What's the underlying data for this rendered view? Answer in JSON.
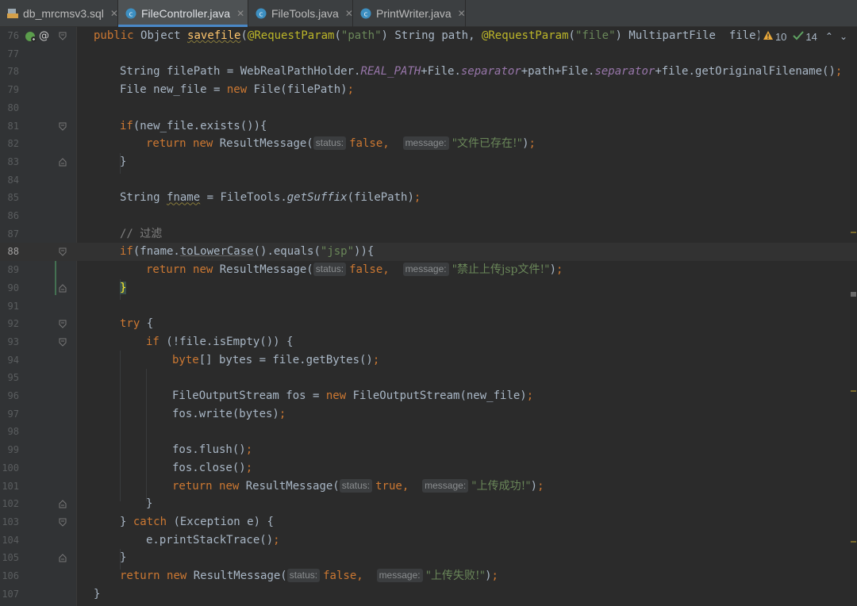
{
  "tabs": [
    {
      "label": "db_mrcmsv3.sql",
      "icon": "sql-file-icon",
      "active": false
    },
    {
      "label": "FileController.java",
      "icon": "java-class-icon",
      "active": true
    },
    {
      "label": "FileTools.java",
      "icon": "java-class-icon",
      "active": false
    },
    {
      "label": "PrintWriter.java",
      "icon": "java-class-icon",
      "active": false
    }
  ],
  "inspection": {
    "warnings": "10",
    "ok": "14"
  },
  "line_numbers": [
    "76",
    "77",
    "78",
    "79",
    "80",
    "81",
    "82",
    "83",
    "84",
    "85",
    "86",
    "87",
    "88",
    "89",
    "90",
    "91",
    "92",
    "93",
    "94",
    "95",
    "96",
    "97",
    "98",
    "99",
    "100",
    "101",
    "102",
    "103",
    "104",
    "105",
    "106",
    "107"
  ],
  "current_line": "88",
  "code": {
    "l76_a": "public ",
    "l76_b": "Object ",
    "l76_fn": "savefile",
    "l76_c": "(",
    "l76_ann1": "@RequestParam",
    "l76_d": "(",
    "l76_s1": "\"path\"",
    "l76_e": ") String path, ",
    "l76_ann2": "@RequestParam",
    "l76_f": "(",
    "l76_s2": "\"file\"",
    "l76_g": ") MultipartFile  file){",
    "l78_a": "String filePath = WebRealPathHolder.",
    "l78_f1": "REAL_PATH",
    "l78_b": "+File.",
    "l78_f2": "separator",
    "l78_c": "+path+File.",
    "l78_f3": "separator",
    "l78_d": "+file.getOriginalFilename()",
    "l78_semi": ";",
    "l79_a": "File new_file = ",
    "l79_kw": "new ",
    "l79_b": "File(filePath)",
    "l79_semi": ";",
    "l81_kw": "if",
    "l81_a": "(new_file.exists()){",
    "l82_kw1": "return ",
    "l82_kw2": "new ",
    "l82_a": "ResultMessage(",
    "l82_h1": "status:",
    "l82_v1": "false",
    "l82_comma": ",",
    "l82_h2": "message:",
    "l82_s": "\"文件已存在!\"",
    "l82_b": ")",
    "l82_semi": ";",
    "l83": "}",
    "l85_a": "String ",
    "l85_var": "fname",
    "l85_b": " = FileTools.",
    "l85_fn": "getSuffix",
    "l85_c": "(filePath)",
    "l85_semi": ";",
    "l87": "// 过滤",
    "l88_kw": "if",
    "l88_a": "(fname.",
    "l88_m": "toLowerCase",
    "l88_b": "().equals(",
    "l88_s": "\"jsp\"",
    "l88_c": ")){",
    "l89_kw1": "return ",
    "l89_kw2": "new ",
    "l89_a": "ResultMessage(",
    "l89_h1": "status:",
    "l89_v1": "false",
    "l89_comma": ",",
    "l89_h2": "message:",
    "l89_s": "\"禁止上传jsp文件!\"",
    "l89_b": ")",
    "l89_semi": ";",
    "l90": "}",
    "l92_kw": "try ",
    "l92_a": "{",
    "l93_kw": "if ",
    "l93_a": "(!file.isEmpty()) {",
    "l94_kw": "byte",
    "l94_a": "[] bytes = file.getBytes()",
    "l94_semi": ";",
    "l96_a": "FileOutputStream fos = ",
    "l96_kw": "new ",
    "l96_b": "FileOutputStream(new_file)",
    "l96_semi": ";",
    "l97_a": "fos.write(bytes)",
    "l97_semi": ";",
    "l99_a": "fos.flush()",
    "l99_semi": ";",
    "l100_a": "fos.close()",
    "l100_semi": ";",
    "l101_kw1": "return ",
    "l101_kw2": "new ",
    "l101_a": "ResultMessage(",
    "l101_h1": "status:",
    "l101_v1": "true",
    "l101_comma": ",",
    "l101_h2": "message:",
    "l101_s": "\"上传成功!\"",
    "l101_b": ")",
    "l101_semi": ";",
    "l102": "}",
    "l103_a": "} ",
    "l103_kw": "catch ",
    "l103_b": "(Exception e) {",
    "l104_a": "e.printStackTrace()",
    "l104_semi": ";",
    "l105": "}",
    "l106_kw1": "return ",
    "l106_kw2": "new ",
    "l106_a": "ResultMessage(",
    "l106_h1": "status:",
    "l106_v1": "false",
    "l106_comma": ",",
    "l106_h2": "message:",
    "l106_s": "\"上传失败!\"",
    "l106_b": ")",
    "l106_semi": ";",
    "l107": "}"
  },
  "colors": {
    "keyword": "#cc7832",
    "string": "#6a8759",
    "annotation": "#bbb529",
    "method": "#ffc66d",
    "static_field": "#9876aa",
    "comment": "#808080",
    "text": "#a9b7c6"
  }
}
